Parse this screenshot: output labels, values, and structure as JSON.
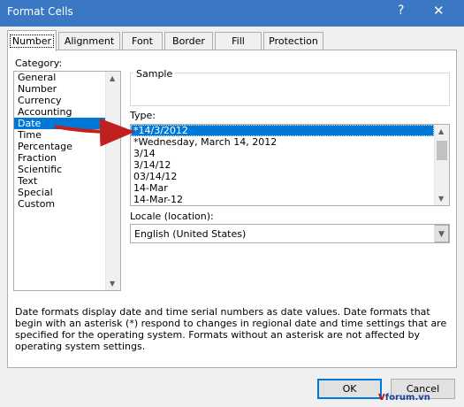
{
  "window": {
    "title": "Format Cells",
    "help": "?",
    "close": "✕"
  },
  "tabs": [
    {
      "label": "Number"
    },
    {
      "label": "Alignment"
    },
    {
      "label": "Font"
    },
    {
      "label": "Border"
    },
    {
      "label": "Fill"
    },
    {
      "label": "Protection"
    }
  ],
  "category": {
    "label": "Category:",
    "items": [
      "General",
      "Number",
      "Currency",
      "Accounting",
      "Date",
      "Time",
      "Percentage",
      "Fraction",
      "Scientific",
      "Text",
      "Special",
      "Custom"
    ],
    "selected": "Date"
  },
  "sample": {
    "label": "Sample"
  },
  "type": {
    "label": "Type:",
    "items": [
      "*14/3/2012",
      "*Wednesday, March 14, 2012",
      "3/14",
      "3/14/12",
      "03/14/12",
      "14-Mar",
      "14-Mar-12"
    ],
    "selected": "*14/3/2012"
  },
  "locale": {
    "label": "Locale (location):",
    "value": "English (United States)"
  },
  "description": "Date formats display date and time serial numbers as date values.  Date formats that begin with an asterisk (*) respond to changes in regional date and time settings that are specified for the operating system. Formats without an asterisk are not affected by operating system settings.",
  "buttons": {
    "ok": "OK",
    "cancel": "Cancel"
  },
  "watermark": {
    "v": "V",
    "rest": "forum.vn"
  },
  "colors": {
    "selection": "#0078d7",
    "titlebar": "#3a78c3",
    "arrow": "#c0201e"
  }
}
